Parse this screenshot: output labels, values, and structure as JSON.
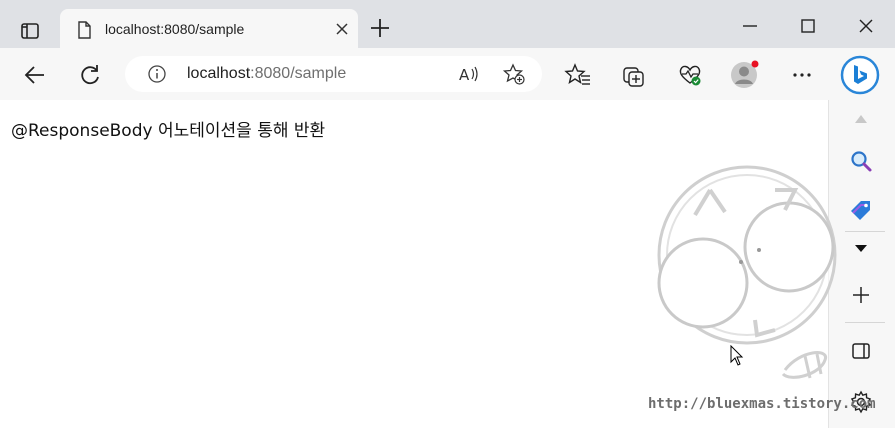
{
  "browser": {
    "tab": {
      "title": "localhost:8080/sample"
    },
    "address": {
      "host": "localhost",
      "path": ":8080/sample"
    }
  },
  "page": {
    "text": "@ResponseBody 어노테이션을 통해 반환"
  },
  "watermark": {
    "text": "http://bluexmas.tistory.com"
  }
}
